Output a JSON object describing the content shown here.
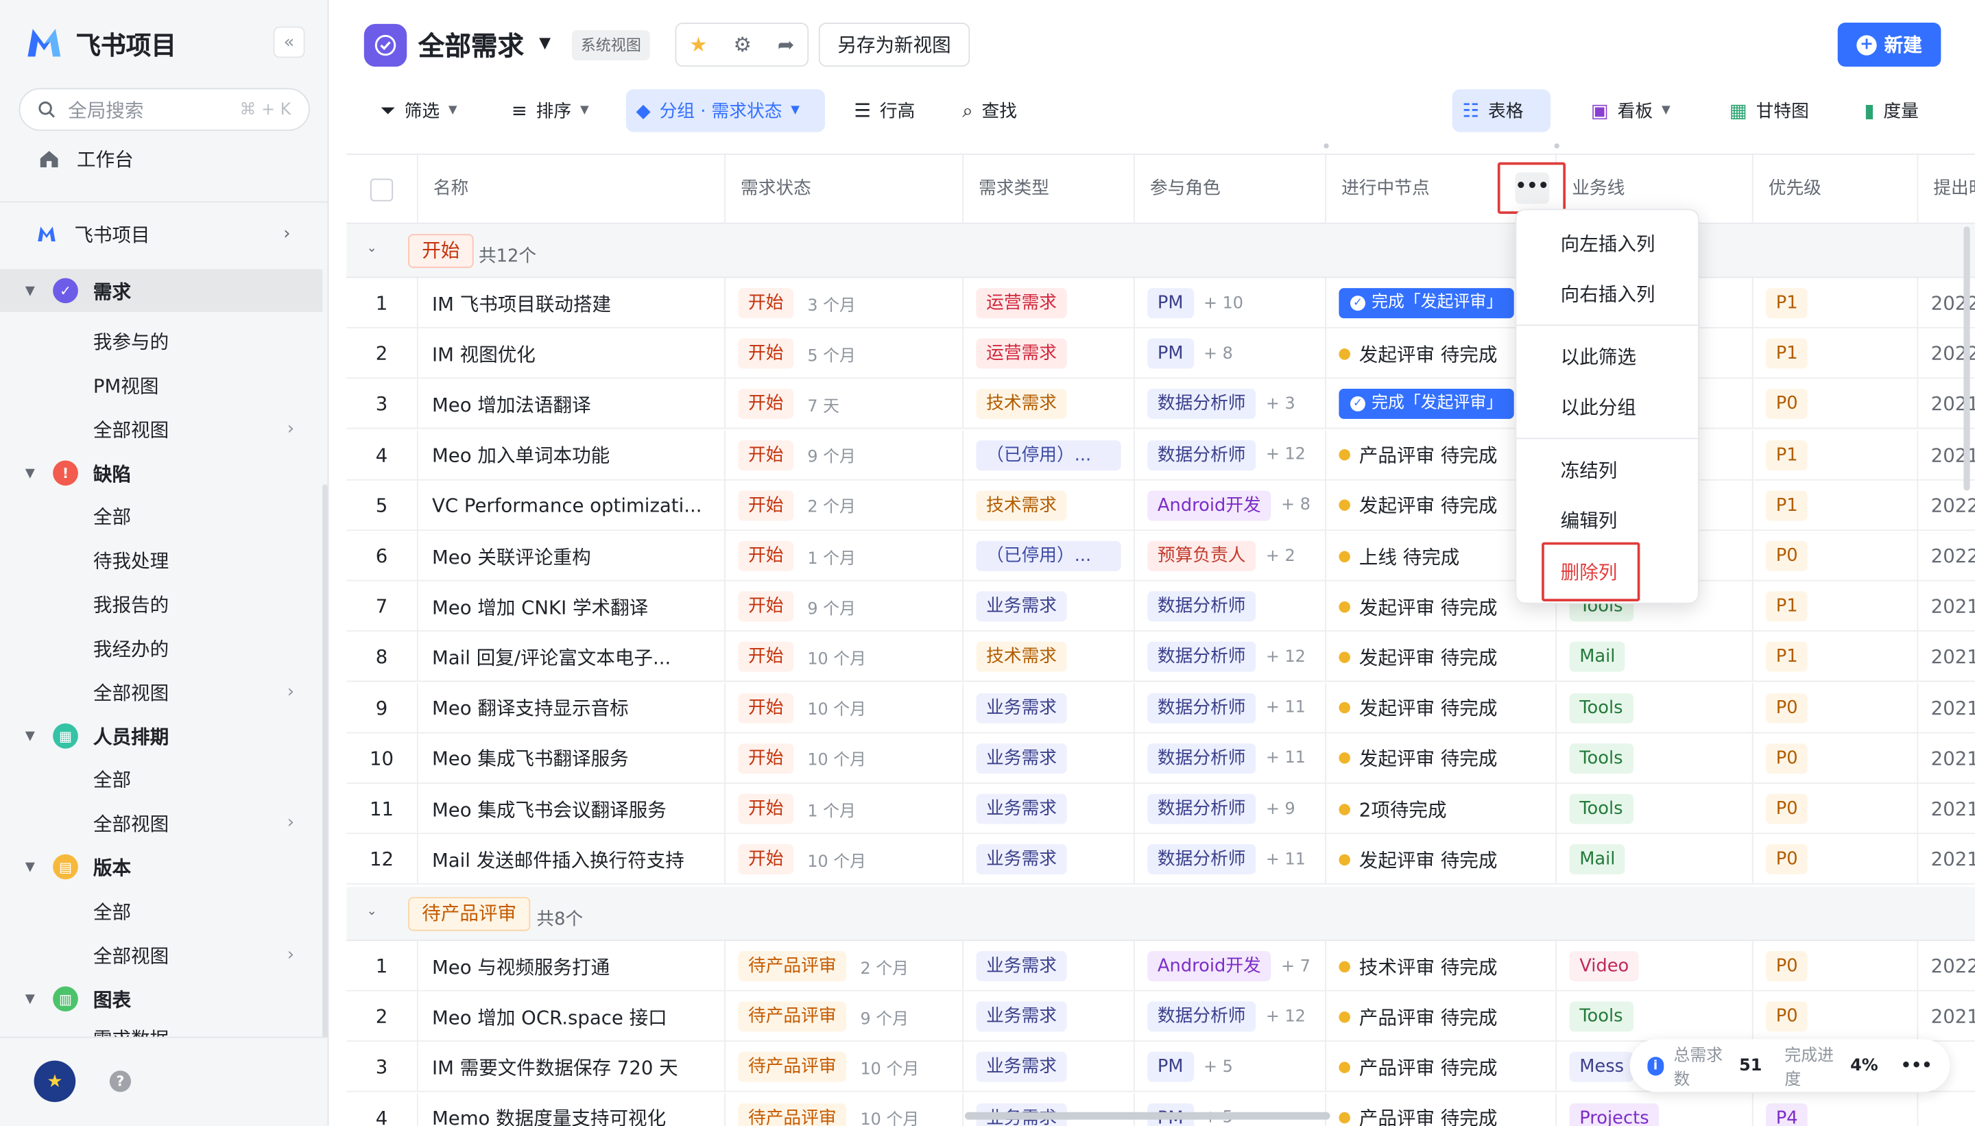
{
  "sidebar": {
    "brand": "飞书项目",
    "search_placeholder": "全局搜索",
    "search_shortcut": "⌘ + K",
    "workbench": "工作台",
    "project": "飞书项目",
    "sections": [
      {
        "label": "需求",
        "color": "#6d5ce8",
        "items": [
          "我参与的",
          "PM视图",
          "全部视图"
        ]
      },
      {
        "label": "缺陷",
        "color": "#f25b4d",
        "items": [
          "全部",
          "待我处理",
          "我报告的",
          "我经办的",
          "全部视图"
        ]
      },
      {
        "label": "人员排期",
        "color": "#34c3a5",
        "items": [
          "全部",
          "全部视图"
        ]
      },
      {
        "label": "版本",
        "color": "#f7b93b",
        "items": [
          "全部",
          "全部视图"
        ]
      },
      {
        "label": "图表",
        "color": "#4cc36a",
        "items": [
          "需求数据"
        ]
      }
    ]
  },
  "header": {
    "title": "全部需求",
    "badge": "系统视图",
    "save_as": "另存为新视图",
    "new": "新建"
  },
  "toolbar": {
    "filter": "筛选",
    "sort": "排序",
    "group": "分组 · 需求状态",
    "row_height": "行高",
    "find": "查找",
    "table": "表格",
    "board": "看板",
    "gantt": "甘特图",
    "measure": "度量"
  },
  "columns": [
    "名称",
    "需求状态",
    "需求类型",
    "参与角色",
    "进行中节点",
    "业务线",
    "优先级",
    "提出时间"
  ],
  "groups": [
    {
      "label": "开始",
      "count": "共12个"
    },
    {
      "label": "待产品评审",
      "count": "共8个"
    }
  ],
  "rows_g1": [
    {
      "idx": "1",
      "name": "IM 飞书项目联动搭建",
      "status": "开始",
      "ago": "3 个月",
      "type": "运营需求",
      "role": "PM",
      "plus": "+ 10",
      "node": "完成「发起评审」",
      "biz": "",
      "pri": "P1",
      "date": "2022"
    },
    {
      "idx": "2",
      "name": "IM 视图优化",
      "status": "开始",
      "ago": "5 个月",
      "type": "运营需求",
      "role": "PM",
      "plus": "+ 8",
      "node": "发起评审 待完成",
      "biz": "",
      "pri": "P1",
      "date": "2022"
    },
    {
      "idx": "3",
      "name": "Meo 增加法语翻译",
      "status": "开始",
      "ago": "7 天",
      "type": "技术需求",
      "role": "数据分析师",
      "plus": "+ 3",
      "node": "完成「发起评审」",
      "biz": "",
      "pri": "P0",
      "date": "2021"
    },
    {
      "idx": "4",
      "name": "Meo 加入单词本功能",
      "status": "开始",
      "ago": "9 个月",
      "type": "（已停用）...",
      "role": "数据分析师",
      "plus": "+ 12",
      "node": "产品评审 待完成",
      "biz": "",
      "pri": "P1",
      "date": "2021"
    },
    {
      "idx": "5",
      "name": "VC Performance optimizati...",
      "status": "开始",
      "ago": "2 个月",
      "type": "技术需求",
      "role": "Android开发",
      "plus": "+ 8",
      "node": "发起评审 待完成",
      "biz": "",
      "pri": "P1",
      "date": "2022"
    },
    {
      "idx": "6",
      "name": "Meo 关联评论重构",
      "status": "开始",
      "ago": "1 个月",
      "type": "（已停用）...",
      "role": "预算负责人",
      "plus": "+ 2",
      "node": "上线 待完成",
      "biz": "",
      "pri": "P0",
      "date": "2022"
    },
    {
      "idx": "7",
      "name": "Meo 增加 CNKI 学术翻译",
      "status": "开始",
      "ago": "9 个月",
      "type": "业务需求",
      "role": "数据分析师",
      "plus": "",
      "node": "发起评审 待完成",
      "biz": "Tools",
      "pri": "P1",
      "date": "2021"
    },
    {
      "idx": "8",
      "name": "Mail 回复/评论富文本电子...",
      "status": "开始",
      "ago": "10 个月",
      "type": "技术需求",
      "role": "数据分析师",
      "plus": "+ 12",
      "node": "发起评审 待完成",
      "biz": "Mail",
      "pri": "P1",
      "date": "2021"
    },
    {
      "idx": "9",
      "name": "Meo 翻译支持显示音标",
      "status": "开始",
      "ago": "10 个月",
      "type": "业务需求",
      "role": "数据分析师",
      "plus": "+ 11",
      "node": "发起评审 待完成",
      "biz": "Tools",
      "pri": "P0",
      "date": "2021"
    },
    {
      "idx": "10",
      "name": "Meo 集成飞书翻译服务",
      "status": "开始",
      "ago": "10 个月",
      "type": "业务需求",
      "role": "数据分析师",
      "plus": "+ 11",
      "node": "发起评审 待完成",
      "biz": "Tools",
      "pri": "P0",
      "date": "2021"
    },
    {
      "idx": "11",
      "name": "Meo 集成飞书会议翻译服务",
      "status": "开始",
      "ago": "1 个月",
      "type": "业务需求",
      "role": "数据分析师",
      "plus": "+ 9",
      "node": "2项待完成",
      "biz": "Tools",
      "pri": "P0",
      "date": "2021"
    },
    {
      "idx": "12",
      "name": "Mail 发送邮件插入换行符支持",
      "status": "开始",
      "ago": "10 个月",
      "type": "业务需求",
      "role": "数据分析师",
      "plus": "+ 11",
      "node": "发起评审 待完成",
      "biz": "Mail",
      "pri": "P0",
      "date": "2021"
    }
  ],
  "rows_g2": [
    {
      "idx": "1",
      "name": "Meo 与视频服务打通",
      "status": "待产品评审",
      "ago": "2 个月",
      "type": "业务需求",
      "role": "Android开发",
      "plus": "+ 7",
      "node": "技术评审 待完成",
      "biz": "Video",
      "pri": "P0",
      "date": "2022"
    },
    {
      "idx": "2",
      "name": "Meo 增加 OCR.space 接口",
      "status": "待产品评审",
      "ago": "9 个月",
      "type": "业务需求",
      "role": "数据分析师",
      "plus": "+ 12",
      "node": "产品评审 待完成",
      "biz": "Tools",
      "pri": "P0",
      "date": "2021"
    },
    {
      "idx": "3",
      "name": "IM 需要文件数据保存 720 天",
      "status": "待产品评审",
      "ago": "10 个月",
      "type": "业务需求",
      "role": "PM",
      "plus": "+ 5",
      "node": "产品评审 待完成",
      "biz": "Mess",
      "pri": "",
      "date": ""
    },
    {
      "idx": "4",
      "name": "Memo 数据度量支持可视化",
      "status": "待产品评审",
      "ago": "10 个月",
      "type": "业务需求",
      "role": "PM",
      "plus": "+ 5",
      "node": "产品评审 待完成",
      "biz": "Projects",
      "pri": "P4",
      "date": ""
    }
  ],
  "menu": [
    "向左插入列",
    "向右插入列",
    "以此筛选",
    "以此分组",
    "冻结列",
    "编辑列",
    "删除列"
  ],
  "stats": {
    "total_label": "总需求数",
    "total": "51",
    "progress_label": "完成进度",
    "progress": "4%"
  }
}
